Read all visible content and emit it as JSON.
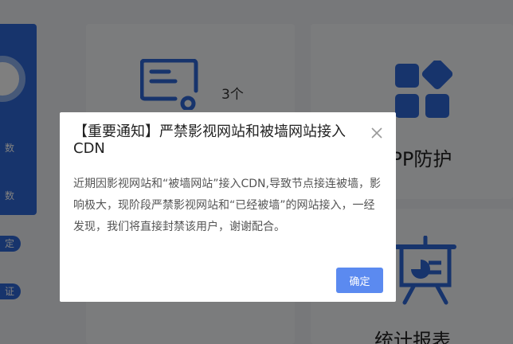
{
  "sidebar": {
    "pills": [
      "数",
      "数",
      "定",
      "证"
    ]
  },
  "cards": {
    "ssl": {
      "count": "3个"
    },
    "app": {
      "title": "APP防护"
    },
    "stats": {
      "title": "统计报表"
    }
  },
  "dialog": {
    "title": "【重要通知】严禁影视网站和被墙网站接入CDN",
    "body": "近期因影视网站和“被墙网站”接入CDN,导致节点接连被墙，影响极大，现阶段严禁影视网站和“已经被墙”的网站接入，一经发现，我们将直接封禁该用户，谢谢配合。",
    "confirm_label": "确定"
  },
  "colors": {
    "primary": "#2f68d8",
    "button": "#5b8af0",
    "overlay": "rgba(0,0,0,0.5)"
  }
}
